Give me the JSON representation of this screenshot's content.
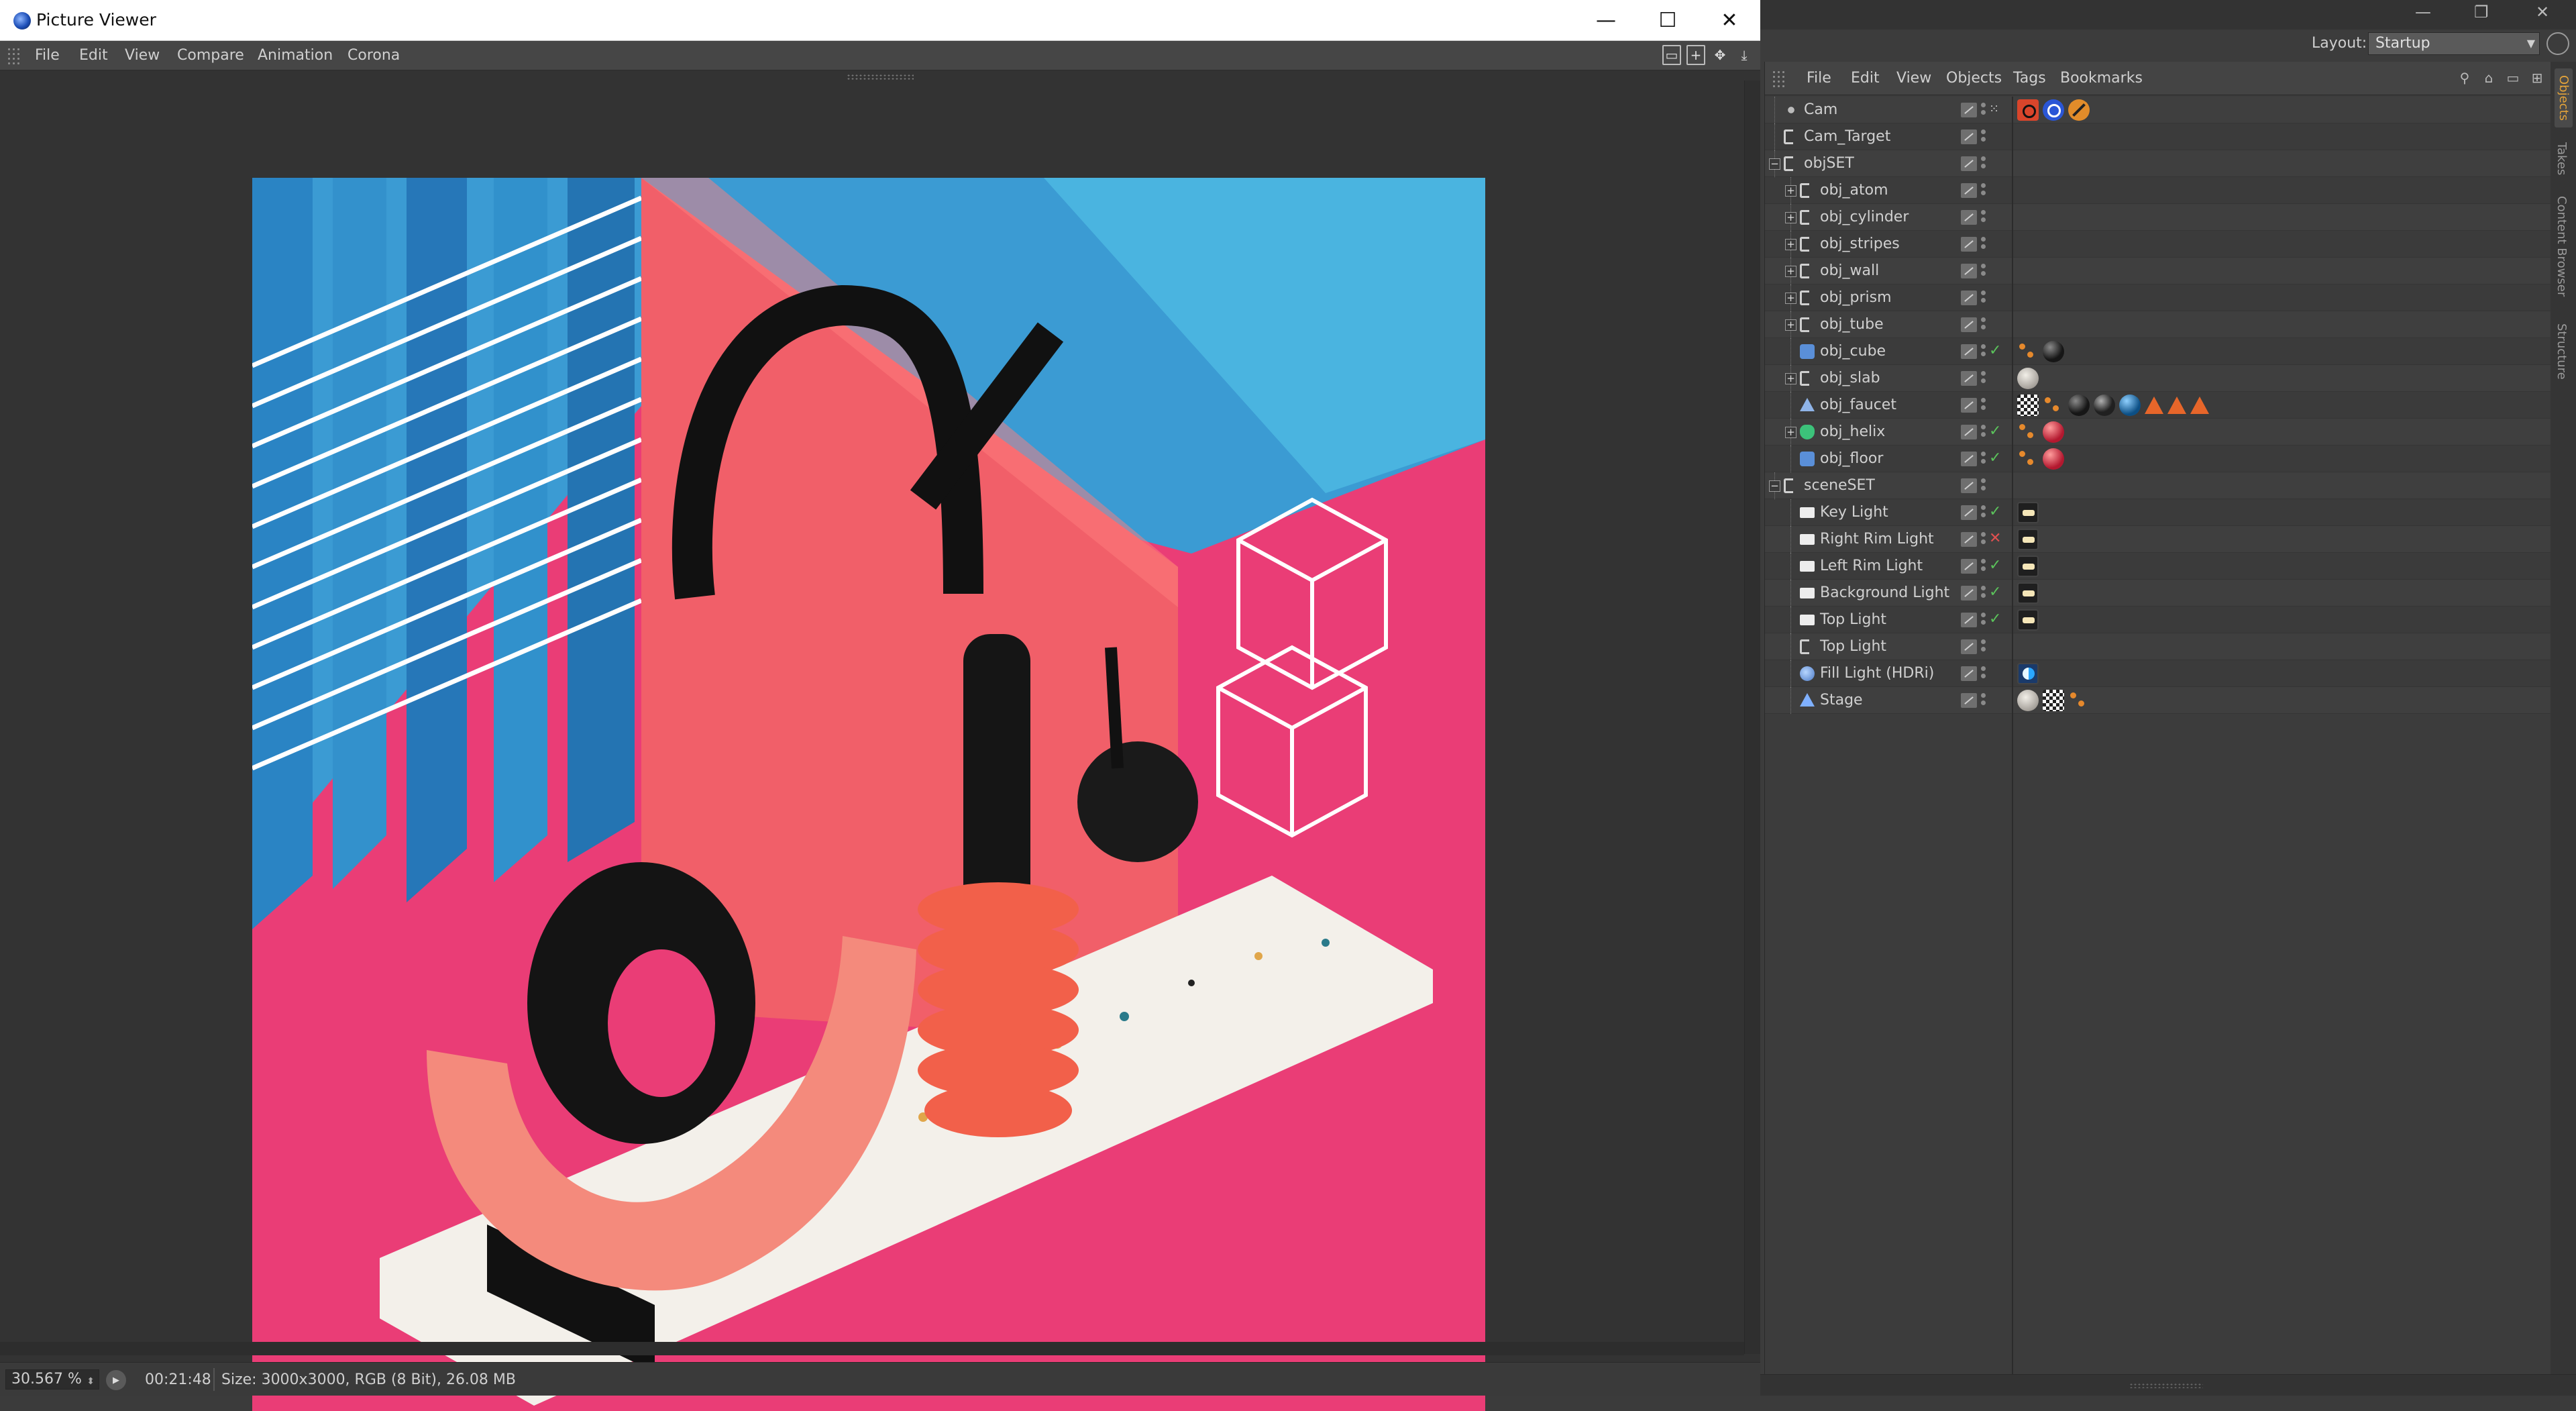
{
  "picture_viewer": {
    "title": "Picture Viewer",
    "window_controls": {
      "minimize": "—",
      "maximize": "☐",
      "close": "✕"
    },
    "menu": [
      "File",
      "Edit",
      "View",
      "Compare",
      "Animation",
      "Corona"
    ],
    "status": {
      "zoom": "30.567 %",
      "render_time": "00:21:48",
      "info": "Size: 3000x3000, RGB (8 Bit), 26.08 MB"
    }
  },
  "layout": {
    "label": "Layout:",
    "value": "Startup"
  },
  "object_manager": {
    "menu": [
      "File",
      "Edit",
      "View",
      "Objects",
      "Tags",
      "Bookmarks"
    ],
    "side_tabs": [
      "Objects",
      "Takes",
      "Content Browser",
      "Structure"
    ],
    "rows": [
      {
        "name": "Cam",
        "icon": "camera-icon",
        "state": "mix",
        "tags": [
          "camcam",
          "target",
          "nope"
        ]
      },
      {
        "name": "Cam_Target",
        "icon": "null-icon",
        "state": "",
        "tags": []
      },
      {
        "name": "objSET",
        "icon": "null-icon",
        "state": "",
        "tags": [],
        "expanded": true
      },
      {
        "name": "obj_atom",
        "icon": "null-icon",
        "state": "",
        "tags": [],
        "collapsed": true
      },
      {
        "name": "obj_cylinder",
        "icon": "null-icon",
        "state": "",
        "tags": [],
        "collapsed": true
      },
      {
        "name": "obj_stripes",
        "icon": "null-icon",
        "state": "",
        "tags": [],
        "collapsed": true
      },
      {
        "name": "obj_wall",
        "icon": "null-icon",
        "state": "",
        "tags": [],
        "collapsed": true
      },
      {
        "name": "obj_prism",
        "icon": "null-icon",
        "state": "",
        "tags": [],
        "collapsed": true
      },
      {
        "name": "obj_tube",
        "icon": "null-icon",
        "state": "",
        "tags": [],
        "collapsed": true
      },
      {
        "name": "obj_cube",
        "icon": "cube-icon",
        "state": "on",
        "tags": [
          "phong",
          "mat-black"
        ]
      },
      {
        "name": "obj_slab",
        "icon": "null-icon",
        "state": "",
        "tags": [
          "mat-terr"
        ],
        "collapsed": true
      },
      {
        "name": "obj_faucet",
        "icon": "polygon-icon",
        "state": "",
        "tags": [
          "checker",
          "phong",
          "mat-black",
          "mat-dark",
          "mat-blue",
          "tri",
          "tri",
          "tri"
        ]
      },
      {
        "name": "obj_helix",
        "icon": "helix-icon",
        "state": "on",
        "tags": [
          "phong",
          "mat-red"
        ],
        "collapsed": true
      },
      {
        "name": "obj_floor",
        "icon": "cube-icon",
        "state": "on",
        "tags": [
          "phong",
          "mat-red"
        ]
      },
      {
        "name": "sceneSET",
        "icon": "null-icon",
        "state": "",
        "tags": [],
        "expanded": true
      },
      {
        "name": "Key Light",
        "icon": "light-icon",
        "state": "on",
        "tags": [
          "light"
        ]
      },
      {
        "name": "Right Rim Light",
        "icon": "light-icon",
        "state": "off",
        "tags": [
          "light"
        ]
      },
      {
        "name": "Left Rim Light",
        "icon": "light-icon",
        "state": "on",
        "tags": [
          "light"
        ]
      },
      {
        "name": "Background Light",
        "icon": "light-icon",
        "state": "on",
        "tags": [
          "light"
        ]
      },
      {
        "name": "Top Light",
        "icon": "light-icon",
        "state": "on",
        "tags": [
          "light"
        ]
      },
      {
        "name": "Top Light",
        "icon": "null-icon",
        "state": "",
        "tags": []
      },
      {
        "name": "Fill Light (HDRi)",
        "icon": "sky-icon",
        "state": "",
        "tags": [
          "hdri"
        ]
      },
      {
        "name": "Stage",
        "icon": "stage-icon",
        "state": "",
        "tags": [
          "mat-terr",
          "checker",
          "phong"
        ]
      }
    ]
  },
  "colors": {
    "render_floor": "#ec3f78",
    "render_wall_blue": "#3e9fd6",
    "render_coral": "#f46a70",
    "state_on": "#5bc25b",
    "state_off": "#e05050"
  }
}
